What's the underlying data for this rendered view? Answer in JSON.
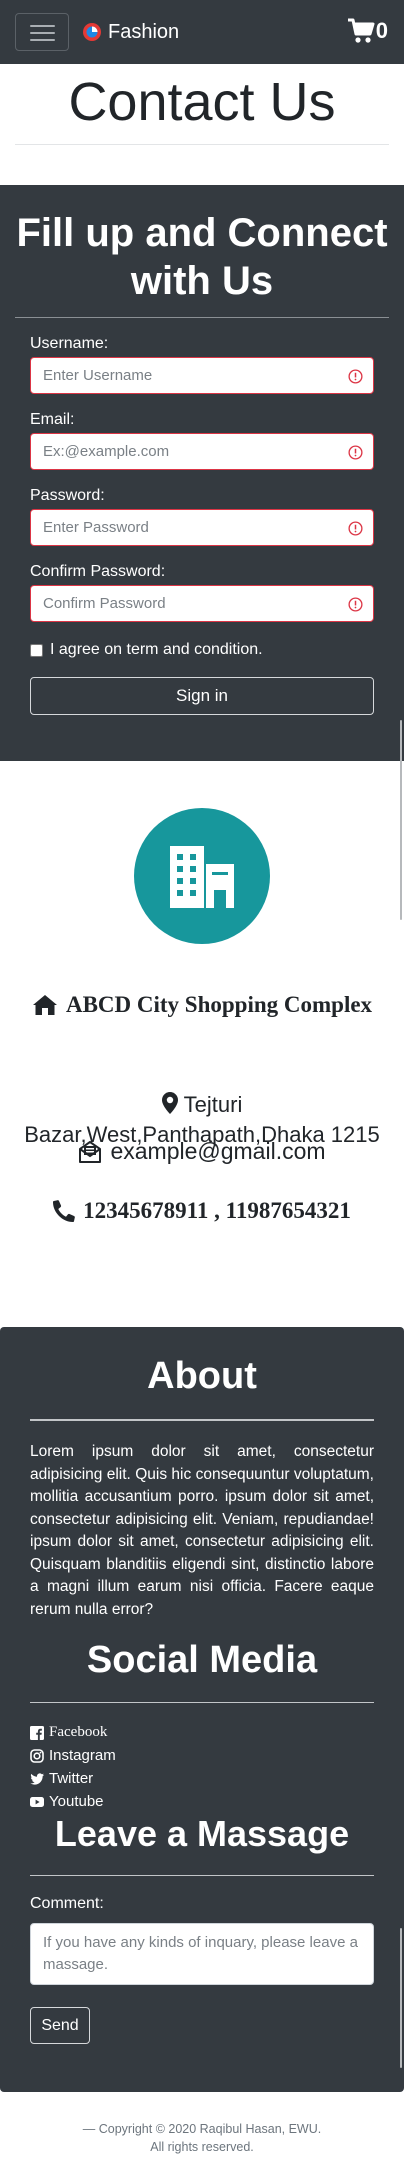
{
  "navbar": {
    "brand_name": "Fashion",
    "cart_count": "0"
  },
  "contact": {
    "title": "Contact Us"
  },
  "form": {
    "title": "Fill up and Connect with Us",
    "username_label": "Username:",
    "username_placeholder": "Enter Username",
    "email_label": "Email:",
    "email_placeholder": "Ex:@example.com",
    "password_label": "Password:",
    "password_placeholder": "Enter Password",
    "confirm_label": "Confirm Password:",
    "confirm_placeholder": "Confirm Password",
    "agree_label": "I agree on term and condition.",
    "signin_label": "Sign in",
    "accent_color": "#dc3545"
  },
  "info": {
    "circle_color": "#17979c",
    "complex": "ABCD City Shopping Complex",
    "address_line1": "Tejturi",
    "address_line2": "Bazar,West,Panthapath,Dhaka 1215",
    "email": "example@gmail.com",
    "phone": "12345678911 , 11987654321"
  },
  "about": {
    "title": "About",
    "text": "Lorem ipsum dolor sit amet, consectetur adipisicing elit. Quis hic consequuntur voluptatum, mollitia accusantium porro. ipsum dolor sit amet, consectetur adipisicing elit. Veniam, repudiandae! ipsum dolor sit amet, consectetur adipisicing elit. Quisquam blanditiis eligendi sint, distinctio labore a magni illum earum nisi officia. Facere eaque rerum nulla error?"
  },
  "social": {
    "title": "Social Media",
    "items": [
      {
        "label": "Facebook",
        "icon": "facebook-icon"
      },
      {
        "label": "Instagram",
        "icon": "instagram-icon"
      },
      {
        "label": "Twitter",
        "icon": "twitter-icon"
      },
      {
        "label": "Youtube",
        "icon": "youtube-icon"
      }
    ]
  },
  "message": {
    "title": "Leave a Massage",
    "comment_label": "Comment:",
    "comment_placeholder": "If you have any kinds of inquary, please leave a massage.",
    "send_label": "Send"
  },
  "footer": {
    "copyright_line1": "— Copyright © 2020 Raqibul Hasan, EWU.",
    "copyright_line2": "All rights reserved."
  },
  "colors": {
    "dark_bg": "#343a40",
    "error": "#dc3545",
    "teal": "#17979c"
  }
}
